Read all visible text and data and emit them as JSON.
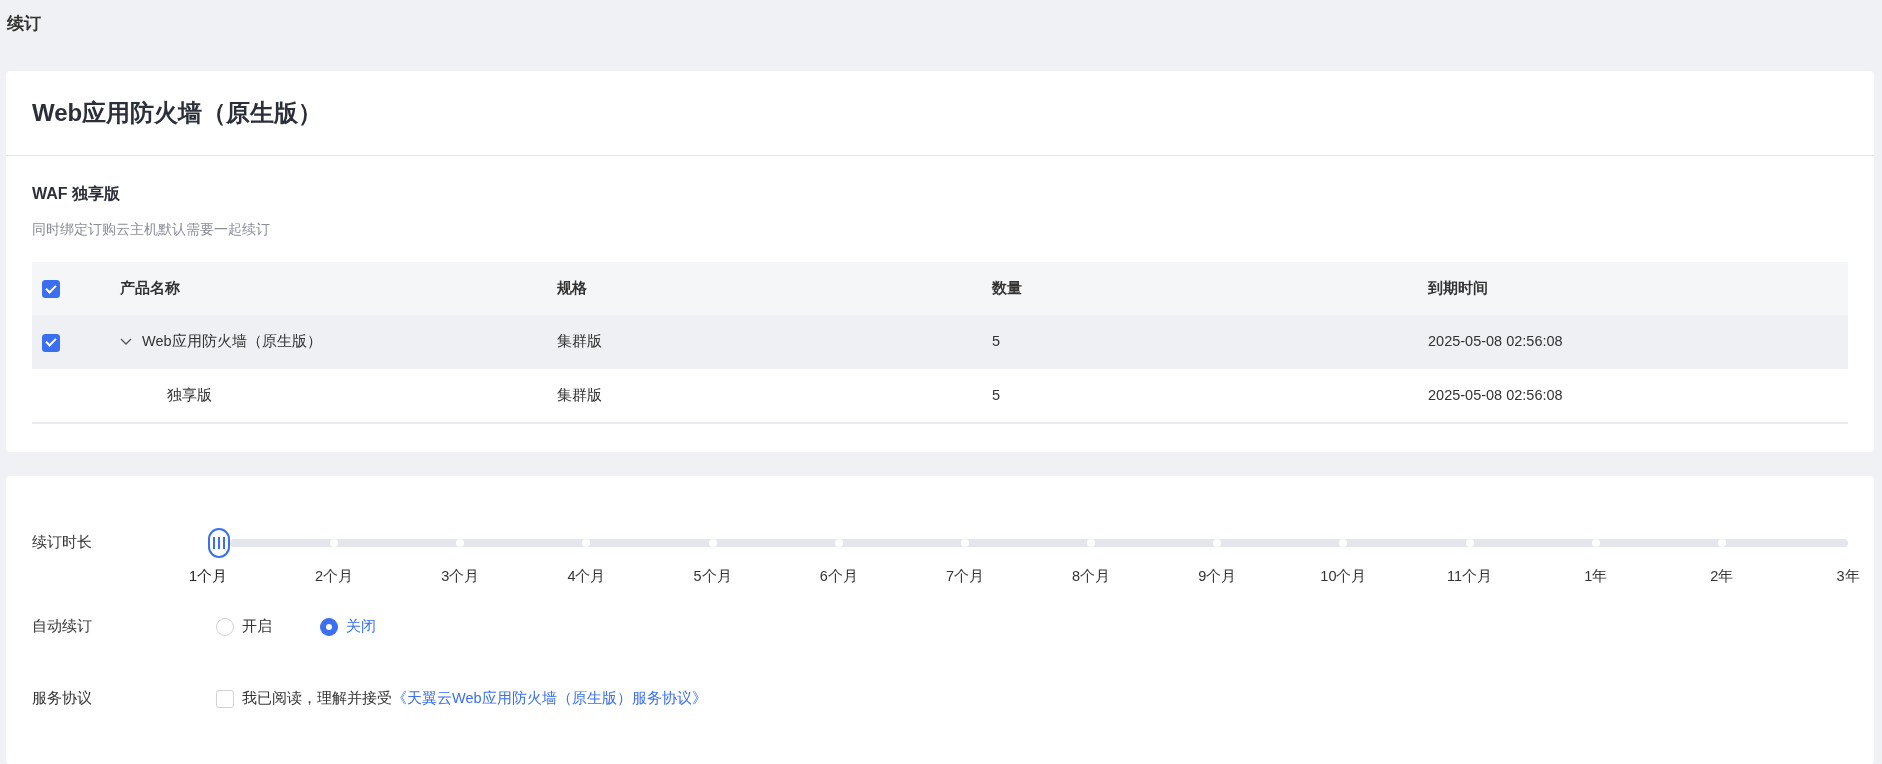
{
  "page_title": "续订",
  "product": {
    "title": "Web应用防火墙（原生版）",
    "section_title": "WAF 独享版",
    "section_note": "同时绑定订购云主机默认需要一起续订",
    "table": {
      "all_checked": true,
      "columns": [
        "产品名称",
        "规格",
        "数量",
        "到期时间"
      ],
      "rows": [
        {
          "name": "Web应用防火墙（原生版）",
          "spec": "集群版",
          "quantity": "5",
          "expires": "2025-05-08 02:56:08",
          "checked": true,
          "expanded": true,
          "children": [
            {
              "name": "独享版",
              "spec": "集群版",
              "quantity": "5",
              "expires": "2025-05-08 02:56:08"
            }
          ]
        }
      ]
    }
  },
  "options": {
    "duration": {
      "label": "续订时长",
      "stops": [
        {
          "label": "1个月",
          "selected": true
        },
        {
          "label": "2个月",
          "selected": false
        },
        {
          "label": "3个月",
          "selected": false
        },
        {
          "label": "4个月",
          "selected": false
        },
        {
          "label": "5个月",
          "selected": false
        },
        {
          "label": "6个月",
          "selected": false
        },
        {
          "label": "7个月",
          "selected": false
        },
        {
          "label": "8个月",
          "selected": false
        },
        {
          "label": "9个月",
          "selected": false
        },
        {
          "label": "10个月",
          "selected": false
        },
        {
          "label": "11个月",
          "selected": false
        },
        {
          "label": "1年",
          "selected": false
        },
        {
          "label": "2年",
          "selected": false
        },
        {
          "label": "3年",
          "selected": false
        }
      ]
    },
    "auto_renew": {
      "label": "自动续订",
      "choices": [
        {
          "label": "开启",
          "selected": false
        },
        {
          "label": "关闭",
          "selected": true
        }
      ]
    },
    "agreement": {
      "label": "服务协议",
      "checked": false,
      "text": "我已阅读，理解并接受",
      "link": "《天翼云Web应用防火墙（原生版）服务协议》"
    }
  }
}
